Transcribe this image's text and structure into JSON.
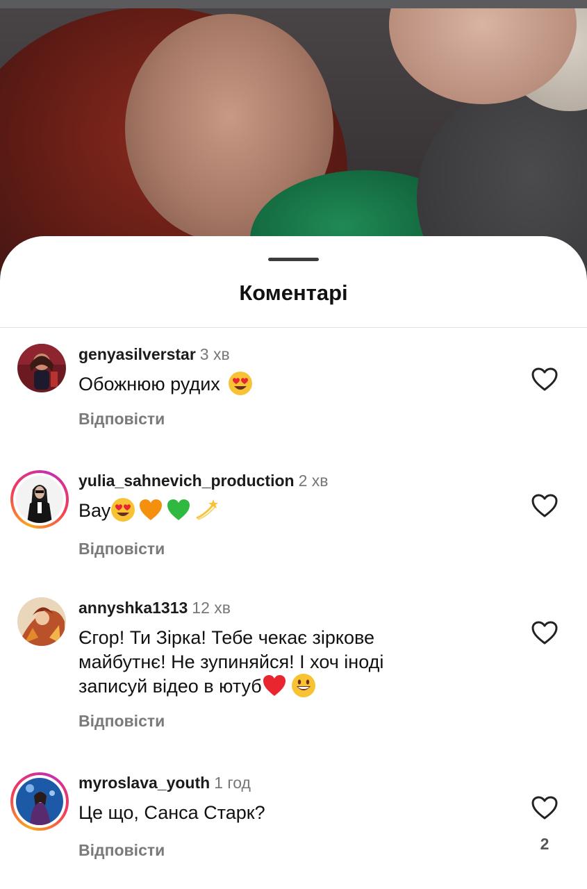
{
  "sheet": {
    "title": "Коментарі"
  },
  "comments": [
    {
      "username": "genyasilverstar",
      "time": "3 хв",
      "text": "Обожнюю рудих",
      "emojis": [
        "heart-eyes"
      ],
      "reply_label": "Відповісти",
      "has_story_ring": false
    },
    {
      "username": "yulia_sahnevich_production",
      "time": "2 хв",
      "text": "Вау",
      "emojis": [
        "heart-eyes",
        "orange-heart",
        "green-heart",
        "dizzy"
      ],
      "reply_label": "Відповісти",
      "has_story_ring": true
    },
    {
      "username": "annyshka1313",
      "time": "12 хв",
      "text_lines": [
        "Єгор! Ти Зірка! Тебе чекає зіркове",
        "майбутнє! Не зупиняйся! І хоч іноді",
        "записуй відео в ютуб"
      ],
      "emojis": [
        "red-heart",
        "grinning"
      ],
      "reply_label": "Відповісти",
      "has_story_ring": false
    },
    {
      "username": "myroslava_youth",
      "time": "1 год",
      "text": "Це що, Санса Старк?",
      "reply_label": "Відповісти",
      "like_count": "2",
      "has_story_ring": true
    }
  ],
  "icons": {
    "like": "heart-outline-icon",
    "handle": "drag-handle"
  },
  "colors": {
    "story_ring": "#f23a5c",
    "secondary_text": "#777777",
    "reply_text": "#7a7a7a"
  }
}
